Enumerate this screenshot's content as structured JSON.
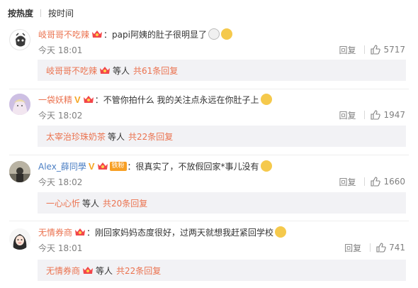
{
  "sort": {
    "hot_label": "按热度",
    "time_label": "按时间"
  },
  "comments": [
    {
      "user": "岐哥哥不吃辣",
      "text": "：papi阿姨的肚子很明显了",
      "time": "今天 18:01",
      "reply_label": "回复",
      "likes": "5717",
      "sub_user": "岐哥哥不吃辣",
      "sub_etc": "等人",
      "sub_total": "共61条回复"
    },
    {
      "user": "一袋妖精",
      "text": "：不管你拍什么 我的关注点永远在你肚子上",
      "time": "今天 18:02",
      "reply_label": "回复",
      "likes": "1947",
      "sub_user": "太宰治珍珠奶茶",
      "sub_etc": "等人",
      "sub_total": "共22条回复"
    },
    {
      "user": "Alex_薛同學",
      "fan_badge": "铁粉",
      "text": "：很真实了，不放假回家*事儿没有",
      "time": "今天 18:02",
      "reply_label": "回复",
      "likes": "1660",
      "sub_user": "一心心忻",
      "sub_etc": "等人",
      "sub_total": "共20条回复"
    },
    {
      "user": "无情券商",
      "text": "：刚回家妈妈态度很好，过两天就想我赶紧回学校",
      "time": "今天 18:01",
      "reply_label": "回复",
      "likes": "741",
      "sub_user": "无情券商",
      "sub_etc": "等人",
      "sub_total": "共22条回复"
    }
  ],
  "colors": {
    "name": "#eb7350",
    "name_blue": "#4a7ec3",
    "meta": "#808080",
    "sub_bg": "#f2f2f5"
  }
}
